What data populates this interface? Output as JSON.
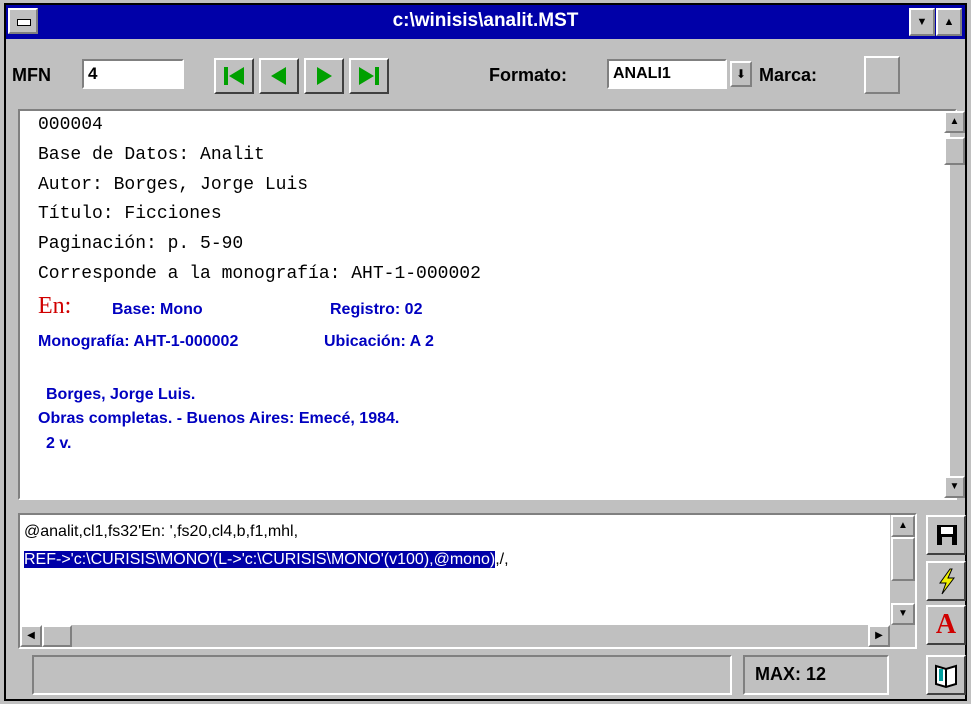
{
  "window": {
    "title": "c:\\winisis\\analit.MST"
  },
  "toolbar": {
    "mfn_label": "MFN",
    "mfn_value": "4",
    "formato_label": "Formato:",
    "formato_value": "ANALI1",
    "marca_label": "Marca:"
  },
  "record": {
    "lines": [
      "000004",
      "Base de Datos: Analit",
      "Autor: Borges, Jorge Luis",
      "Título: Ficciones",
      "Paginación: p. 5-90",
      "Corresponde a la monografía: AHT-1-000002"
    ],
    "en_label": "En:",
    "base": "Base: Mono",
    "registro": "Registro: 02",
    "monografia": "Monografía: AHT-1-000002",
    "ubicacion": "Ubicación: A 2",
    "ref_author": "Borges, Jorge Luis.",
    "ref_title": "Obras completas. - Buenos Aires: Emecé, 1984.",
    "ref_vols": "2 v."
  },
  "format_editor": {
    "line1": "@analit,cl1,fs32'En: ',fs20,cl4,b,f1,mhl,",
    "line2_selected": "REF->'c:\\CURISIS\\MONO'(L->'c:\\CURISIS\\MONO'(v100),@mono)",
    "line2_rest": ",/,"
  },
  "statusbar": {
    "max_label": "MAX: 12"
  },
  "icons": {
    "nav": [
      "first-record-icon",
      "previous-record-icon",
      "next-record-icon",
      "last-record-icon"
    ],
    "side": [
      "save-format-icon",
      "apply-format-icon",
      "font-icon"
    ],
    "status": [
      "book-icon"
    ]
  },
  "colors": {
    "title_bar": "#0000a8",
    "field_text": "#0000c0",
    "en_red": "#d00000",
    "nav_green": "#00a000"
  }
}
